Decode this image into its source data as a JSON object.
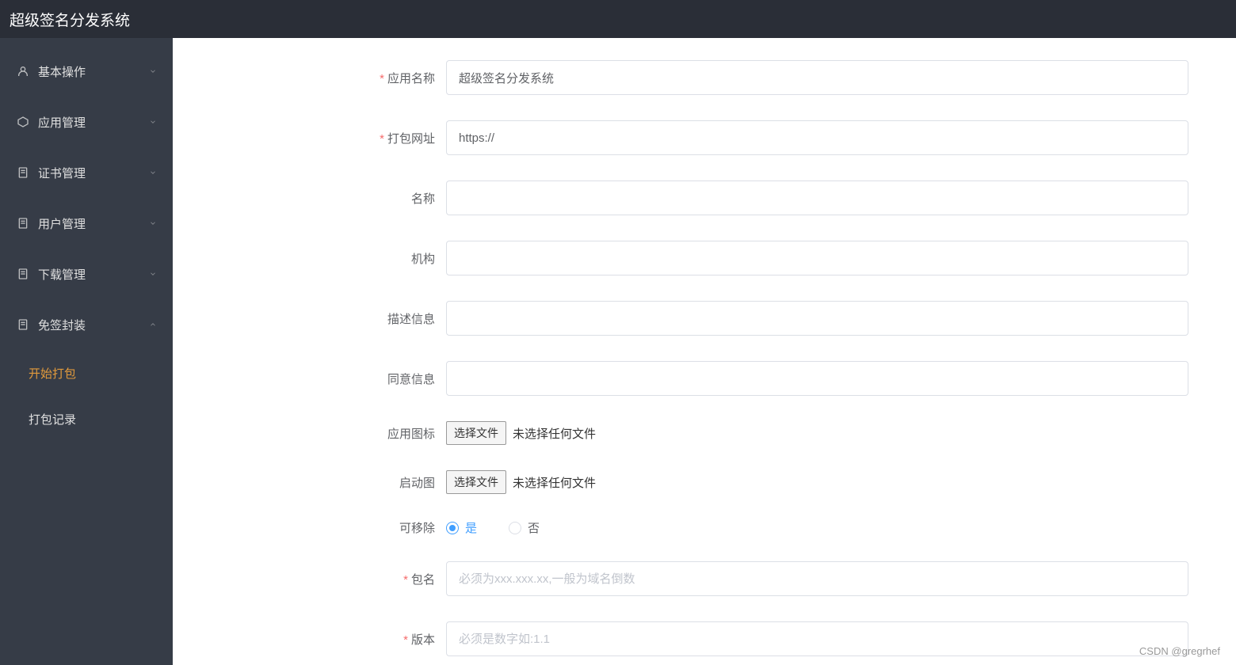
{
  "header": {
    "title": "超级签名分发系统"
  },
  "sidebar": {
    "items": [
      {
        "label": "基本操作",
        "icon": "user"
      },
      {
        "label": "应用管理",
        "icon": "box"
      },
      {
        "label": "证书管理",
        "icon": "doc"
      },
      {
        "label": "用户管理",
        "icon": "doc"
      },
      {
        "label": "下载管理",
        "icon": "doc"
      },
      {
        "label": "免签封装",
        "icon": "doc",
        "expanded": true
      }
    ],
    "subitems": [
      {
        "label": "开始打包",
        "active": true
      },
      {
        "label": "打包记录",
        "active": false
      }
    ]
  },
  "form": {
    "app_name": {
      "label": "应用名称",
      "value": "超级签名分发系统",
      "required": true
    },
    "package_url": {
      "label": "打包网址",
      "value": "https://",
      "required": true
    },
    "name": {
      "label": "名称",
      "value": ""
    },
    "org": {
      "label": "机构",
      "value": ""
    },
    "description": {
      "label": "描述信息",
      "value": ""
    },
    "agree_info": {
      "label": "同意信息",
      "value": ""
    },
    "app_icon": {
      "label": "应用图标",
      "button": "选择文件",
      "status": "未选择任何文件"
    },
    "launch_image": {
      "label": "启动图",
      "button": "选择文件",
      "status": "未选择任何文件"
    },
    "removable": {
      "label": "可移除",
      "yes": "是",
      "no": "否",
      "selected": "yes"
    },
    "package_name": {
      "label": "包名",
      "placeholder": "必须为xxx.xxx.xx,一般为域名倒数",
      "required": true
    },
    "version": {
      "label": "版本",
      "placeholder": "必须是数字如:1.1",
      "required": true
    }
  },
  "watermark": "CSDN @gregrhef"
}
